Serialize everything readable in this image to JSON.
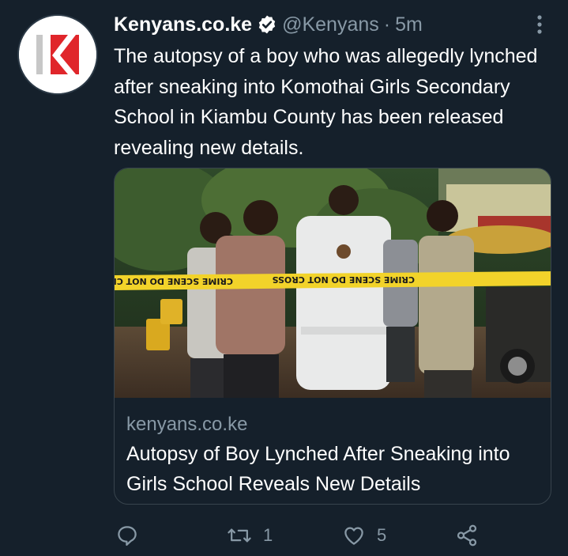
{
  "tweet": {
    "display_name": "Kenyans.co.ke",
    "handle": "@Kenyans",
    "separator": "·",
    "time": "5m",
    "text": "The autopsy of a boy who was allegedly lynched after sneaking into Komothai Girls Secondary School in Kiambu County has been released revealing new details.",
    "card": {
      "domain": "kenyans.co.ke",
      "title": "Autopsy of Boy Lynched After Sneaking into Girls School Reveals New Details",
      "tape_text": "CRIME SCENE DO NOT CROSS"
    },
    "actions": {
      "reply_count": "",
      "retweet_count": "1",
      "like_count": "5"
    }
  },
  "icons": {
    "verified": "verified-badge-icon",
    "more": "more-vertical-icon",
    "reply": "reply-icon",
    "retweet": "retweet-icon",
    "like": "heart-icon",
    "share": "share-icon"
  },
  "colors": {
    "background": "#15202b",
    "secondary_text": "#8899a6",
    "border": "#38444d",
    "brand_red": "#e0262b"
  }
}
